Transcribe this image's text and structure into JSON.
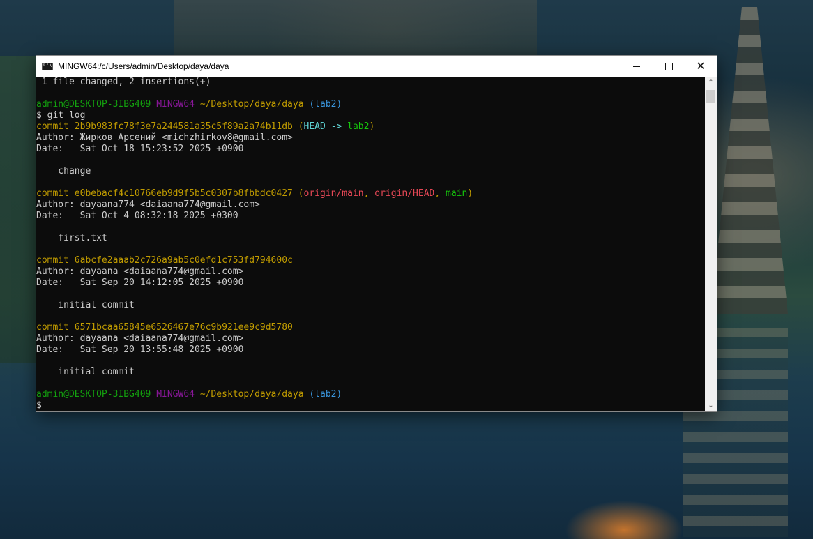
{
  "window": {
    "title": "MINGW64:/c/Users/admin/Desktop/daya/daya",
    "icon": "console-icon",
    "controls": {
      "minimize": "minimize-icon",
      "maximize": "maximize-icon",
      "close": "close-icon",
      "close_glyph": "✕"
    }
  },
  "terminal": {
    "lines": [
      [
        {
          "t": " 1 file changed, 2 insertions(+)",
          "c": "white"
        }
      ],
      [],
      [
        {
          "t": "admin@DESKTOP-3IBG409 ",
          "c": "green"
        },
        {
          "t": "MINGW64 ",
          "c": "magenta"
        },
        {
          "t": "~/Desktop/daya/daya ",
          "c": "yellow"
        },
        {
          "t": "(lab2)",
          "c": "cyan"
        }
      ],
      [
        {
          "t": "$ git log",
          "c": "white"
        }
      ],
      [
        {
          "t": "commit 2b9b983fc78f3e7a244581a35c5f89a2a74b11db ",
          "c": "yellow"
        },
        {
          "t": "(",
          "c": "yellow"
        },
        {
          "t": "HEAD -> ",
          "c": "cyanbright"
        },
        {
          "t": "lab2",
          "c": "greenbright"
        },
        {
          "t": ")",
          "c": "yellow"
        }
      ],
      [
        {
          "t": "Author: Жирков Арсений <michzhirkov8@gmail.com>",
          "c": "white"
        }
      ],
      [
        {
          "t": "Date:   Sat Oct 18 15:23:52 2025 +0900",
          "c": "white"
        }
      ],
      [],
      [
        {
          "t": "    change",
          "c": "white"
        }
      ],
      [],
      [
        {
          "t": "commit e0bebacf4c10766eb9d9f5b5c0307b8fbbdc0427 ",
          "c": "yellow"
        },
        {
          "t": "(",
          "c": "yellow"
        },
        {
          "t": "origin/main",
          "c": "red"
        },
        {
          "t": ", ",
          "c": "yellow"
        },
        {
          "t": "origin/HEAD",
          "c": "red"
        },
        {
          "t": ", ",
          "c": "yellow"
        },
        {
          "t": "main",
          "c": "greenbright"
        },
        {
          "t": ")",
          "c": "yellow"
        }
      ],
      [
        {
          "t": "Author: dayaana774 <daiaana774@gmail.com>",
          "c": "white"
        }
      ],
      [
        {
          "t": "Date:   Sat Oct 4 08:32:18 2025 +0300",
          "c": "white"
        }
      ],
      [],
      [
        {
          "t": "    first.txt",
          "c": "white"
        }
      ],
      [],
      [
        {
          "t": "commit 6abcfe2aaab2c726a9ab5c0efd1c753fd794600c",
          "c": "yellow"
        }
      ],
      [
        {
          "t": "Author: dayaana <daiaana774@gmail.com>",
          "c": "white"
        }
      ],
      [
        {
          "t": "Date:   Sat Sep 20 14:12:05 2025 +0900",
          "c": "white"
        }
      ],
      [],
      [
        {
          "t": "    initial commit",
          "c": "white"
        }
      ],
      [],
      [
        {
          "t": "commit 6571bcaa65845e6526467e76c9b921ee9c9d5780",
          "c": "yellow"
        }
      ],
      [
        {
          "t": "Author: dayaana <daiaana774@gmail.com>",
          "c": "white"
        }
      ],
      [
        {
          "t": "Date:   Sat Sep 20 13:55:48 2025 +0900",
          "c": "white"
        }
      ],
      [],
      [
        {
          "t": "    initial commit",
          "c": "white"
        }
      ],
      [],
      [
        {
          "t": "admin@DESKTOP-3IBG409 ",
          "c": "green"
        },
        {
          "t": "MINGW64 ",
          "c": "magenta"
        },
        {
          "t": "~/Desktop/daya/daya ",
          "c": "yellow"
        },
        {
          "t": "(lab2)",
          "c": "cyan"
        }
      ],
      [
        {
          "t": "$",
          "c": "white"
        }
      ]
    ]
  },
  "scrollbar": {
    "up_glyph": "⌃",
    "down_glyph": "⌄"
  },
  "colors": {
    "green": "#13a10e",
    "magenta": "#881798",
    "yellow": "#c19c00",
    "cyan": "#3a96dd",
    "cyanbright": "#61d6d6",
    "red": "#e74856",
    "greenbright": "#16c60c",
    "white": "#cccccc",
    "terminal_bg": "#0c0c0c"
  }
}
